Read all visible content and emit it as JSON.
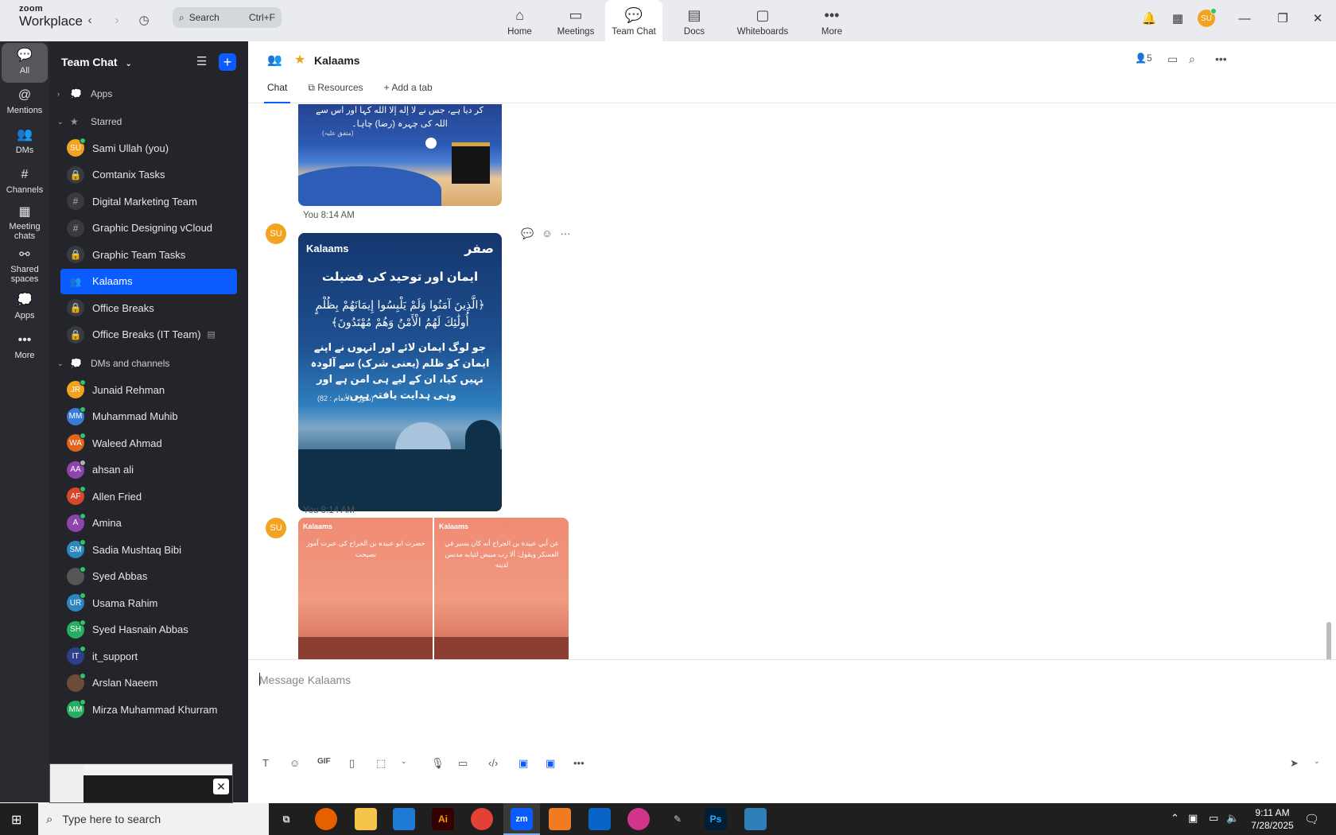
{
  "app": {
    "brand_top": "zoom",
    "brand_bottom": "Workplace",
    "search_placeholder": "Search",
    "search_shortcut": "Ctrl+F",
    "tabs": [
      {
        "label": "Home",
        "icon": "⌂"
      },
      {
        "label": "Meetings",
        "icon": "▭"
      },
      {
        "label": "Team Chat",
        "icon": "💬"
      },
      {
        "label": "Docs",
        "icon": "▤"
      },
      {
        "label": "Whiteboards",
        "icon": "▢"
      },
      {
        "label": "More",
        "icon": "•••"
      }
    ],
    "profile_initials": "SU"
  },
  "rail": [
    {
      "label": "All",
      "icon": "💬"
    },
    {
      "label": "Mentions",
      "icon": "@"
    },
    {
      "label": "DMs",
      "icon": "👥"
    },
    {
      "label": "Channels",
      "icon": "#"
    },
    {
      "label": "Meeting chats",
      "icon": "▦"
    },
    {
      "label": "Shared spaces",
      "icon": "⚯"
    },
    {
      "label": "Apps",
      "icon": "💭"
    },
    {
      "label": "More",
      "icon": "•••"
    }
  ],
  "sidebar": {
    "title": "Team Chat",
    "sections": {
      "apps": "Apps",
      "starred": "Starred",
      "dms": "DMs and channels"
    },
    "starred": [
      {
        "label": "Sami Ullah (you)",
        "type": "avatar",
        "initials": "SU",
        "color": "#f4a320",
        "status": "online"
      },
      {
        "label": "Comtanix Tasks",
        "type": "lock"
      },
      {
        "label": "Digital Marketing Team",
        "type": "hash"
      },
      {
        "label": "Graphic Designing vCloud",
        "type": "hash"
      },
      {
        "label": "Graphic Team Tasks",
        "type": "lock"
      },
      {
        "label": "Kalaams",
        "type": "people",
        "active": true
      },
      {
        "label": "Office Breaks",
        "type": "lock"
      },
      {
        "label": "Office Breaks (IT Team)",
        "type": "lock",
        "archived": true
      }
    ],
    "dms": [
      {
        "label": "Junaid Rehman",
        "initials": "JR",
        "color": "#f4a320",
        "status": "online"
      },
      {
        "label": "Muhammad Muhib",
        "initials": "MM",
        "color": "#3a7bd5",
        "status": "online"
      },
      {
        "label": "Waleed Ahmad",
        "initials": "WA",
        "color": "#e0641a",
        "status": "online"
      },
      {
        "label": "ahsan ali",
        "initials": "AA",
        "color": "#8e44ad",
        "status": "away"
      },
      {
        "label": "Allen Fried",
        "initials": "AF",
        "color": "#d9472b",
        "status": "online"
      },
      {
        "label": "Amina",
        "initials": "A",
        "color": "#8e44ad",
        "status": "online"
      },
      {
        "label": "Sadia Mushtaq Bibi",
        "initials": "SM",
        "color": "#2e86c1",
        "status": "online"
      },
      {
        "label": "Syed Abbas",
        "initials": "",
        "color": "#555555",
        "status": "online"
      },
      {
        "label": "Usama Rahim",
        "initials": "UR",
        "color": "#2e86c1",
        "status": "online"
      },
      {
        "label": "Syed Hasnain Abbas",
        "initials": "SH",
        "color": "#27ae60",
        "status": "online"
      },
      {
        "label": "it_support",
        "initials": "IT",
        "color": "#2c3e8c",
        "status": "online"
      },
      {
        "label": "Arslan Naeem",
        "initials": "",
        "color": "#6b4b3a",
        "status": "online"
      },
      {
        "label": "Mirza Muhammad Khurram",
        "initials": "MM",
        "color": "#27ae60",
        "status": "online"
      }
    ]
  },
  "channel": {
    "title": "Kalaams",
    "tabs": [
      "Chat",
      "Resources",
      "Add a tab"
    ],
    "member_count": "5"
  },
  "messages": [
    {
      "id": "m1",
      "urdu": "کر دیا ہے، جس نے لا إله إلا الله کہا اور اس سے اللہ کی چہرہ (رضا) چاہا۔",
      "ref": "(متفق علیہ)"
    },
    {
      "id": "m2",
      "sender": "You",
      "time": "8:14 AM",
      "initials": "SU",
      "logo": "Kalaams",
      "title": "ایمان اور توحید کی فضیلت",
      "arabic": "﴿الَّذِينَ آمَنُوا وَلَمْ يَلْبِسُوا إِيمَانَهُمْ بِظُلْمٍ أُولَٰئِكَ لَهُمُ الْأَمْنُ وَهُمْ مُهْتَدُونَ﴾",
      "urdu": "جو لوگ ایمان لائے اور انہوں نے اپنے ایمان کو ظلم (یعنی شرک) سے آلودہ نہیں کیا، ان کے لیے ہی امن ہے اور وہی ہدایت یافتہ ہیں۔",
      "ref": "(سورۃ الأنعام : 82)"
    },
    {
      "id": "m3",
      "sender": "You",
      "time": "8:14 AM",
      "initials": "SU",
      "left_logo": "Kalaams",
      "right_logo": "Kalaams",
      "left_text": "حضرت ابو عبیدہ بن الجراح کی عبرت آموز نصیحت",
      "right_text": "عن أبي عبيدة بن الجراح أنه كان يسير في العسكر ويقول: ألا رب مبيض لثيابه مدنس لدينه"
    }
  ],
  "composer": {
    "placeholder": "Message Kalaams"
  },
  "taskbar": {
    "search_placeholder": "Type here to search",
    "time": "9:11 AM",
    "date": "7/28/2025"
  },
  "colors": {
    "accent": "#0b5cff",
    "sidebar_bg": "#24252a",
    "rail_bg": "#2a2b30",
    "online": "#2ec46b"
  }
}
